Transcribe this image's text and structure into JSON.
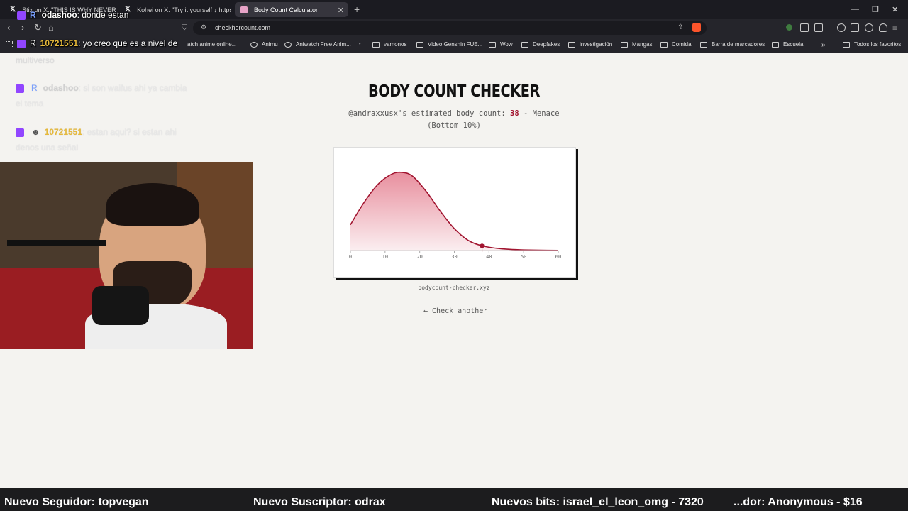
{
  "browser": {
    "tabs": [
      {
        "label": "Stix on X: \"THIS IS WHY NEVERNESS",
        "icon": "x-logo-icon"
      },
      {
        "label": "Kohei on X: \"Try it yourself ↓ https://",
        "icon": "x-logo-icon"
      },
      {
        "label": "Body Count Calculator",
        "icon": "site-favicon",
        "active": true
      }
    ],
    "url": "checkhercount.com",
    "bookmarks": [
      "Animu",
      "Aniwatch Free Anim...",
      "vamonos",
      "Video Genshin FUE...",
      "Wow",
      "Deepfakes",
      "investigación",
      "Mangas",
      "Comida",
      "Barra de marcadores",
      "Escuela"
    ],
    "bookmarks_partial": "atch anime online...",
    "all_bookmarks": "Todos los favoritos"
  },
  "overlay": {
    "top_user": "odashoo",
    "top_msg": ": donde estan",
    "second_user": "10721551",
    "second_msg": ": yo creo que es a nivel de"
  },
  "chat": [
    {
      "text": "multiverso"
    },
    {
      "user": "odashoo",
      "msg": ": si son waifus ahi ya cambia"
    },
    {
      "text": "el tema"
    },
    {
      "user": "10721551",
      "msg": ": estan aqui? si estan ahi"
    },
    {
      "text": "denos una señal"
    }
  ],
  "page": {
    "title": "BODY COUNT CHECKER",
    "subtitle_pre": "@andraxxusx's estimated body count: ",
    "count": "38",
    "subtitle_post": " - Menace",
    "subtitle_line2": "(Bottom 10%)",
    "footer_url": "bodycount-checker.xyz",
    "check_another": "← Check another"
  },
  "chart_data": {
    "type": "area",
    "x_ticks": [
      "0",
      "10",
      "20",
      "30",
      "40",
      "50",
      "60"
    ],
    "xlim": [
      0,
      60
    ],
    "x": [
      0,
      4,
      8,
      12,
      15,
      18,
      22,
      26,
      30,
      34,
      38,
      42,
      46,
      50,
      55,
      60
    ],
    "y": [
      0.33,
      0.62,
      0.85,
      0.98,
      1.0,
      0.95,
      0.75,
      0.5,
      0.28,
      0.13,
      0.06,
      0.03,
      0.015,
      0.008,
      0.004,
      0.002
    ],
    "ylim": [
      0,
      1.1
    ],
    "highlight": {
      "x": 38,
      "y": 0.06
    },
    "colors": {
      "line": "#a1142f",
      "fill_top": "#e88f9e",
      "fill_bottom": "#fbeef0"
    }
  },
  "stream_bar": {
    "follower": "Nuevo Seguidor: topvegan",
    "subscriber": "Nuevo Suscriptor: odrax",
    "bits": "Nuevos bits: israel_el_leon_omg - 7320",
    "donor": "...dor: Anonymous - $16"
  }
}
